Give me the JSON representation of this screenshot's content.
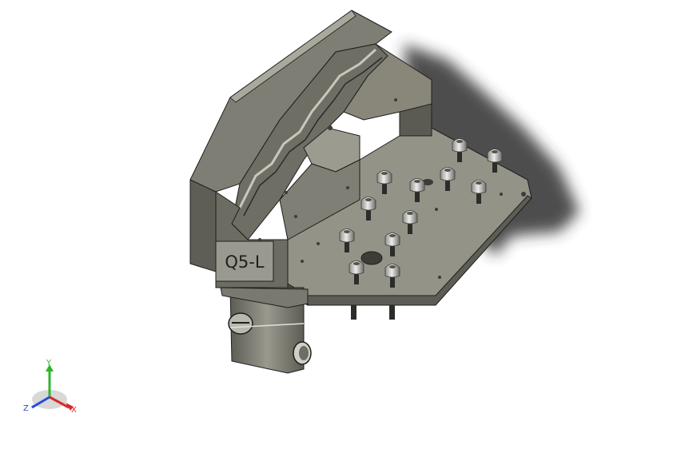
{
  "model": {
    "part_label": "Q5-L",
    "colors": {
      "body_dark": "#6e6c62",
      "body_mid": "#86857b",
      "body_light": "#a3a297",
      "plate_top": "#98978c",
      "edge": "#1e1e1c",
      "shadow": "#3a3a3a",
      "bolt": "#c9c9c4",
      "bolt_dark": "#55544f"
    }
  },
  "triad": {
    "x_label": "X",
    "y_label": "Y",
    "z_label": "Z",
    "x_color": "#d62a2a",
    "y_color": "#2fb52f",
    "z_color": "#2a4ad6"
  }
}
